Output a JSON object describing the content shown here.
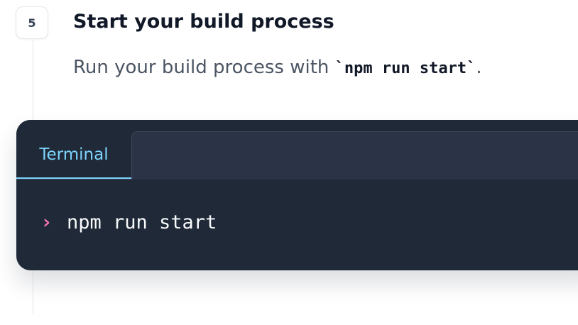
{
  "step": {
    "number": "5",
    "title": "Start your build process",
    "description_prefix": "Run your build process with ",
    "description_code": "`npm run start`",
    "description_suffix": "."
  },
  "terminal": {
    "tab_label": "Terminal",
    "prompt_symbol": "›",
    "command": "npm run start"
  },
  "colors": {
    "accent": "#7dd3fc",
    "prompt": "#f472b6",
    "terminal_background": "#1f2937"
  },
  "icons": {
    "prompt": "chevron-right-icon"
  }
}
